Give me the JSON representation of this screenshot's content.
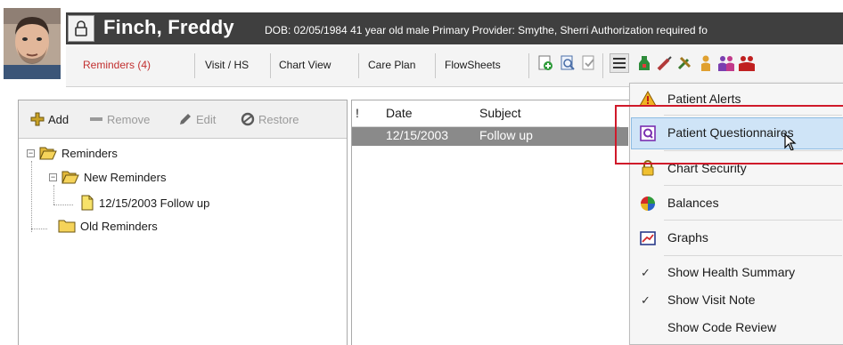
{
  "patient": {
    "name": "Finch, Freddy",
    "info": "DOB: 02/05/1984  41 year old male  Primary Provider: Smythe, Sherri  Authorization required fo"
  },
  "toolbar": {
    "reminders": "Reminders (4)",
    "visit": "Visit / HS",
    "chart_view": "Chart View",
    "care_plan": "Care Plan",
    "flowsheets": "FlowSheets"
  },
  "reminders_toolbar": {
    "add": "Add",
    "remove": "Remove",
    "edit": "Edit",
    "restore": "Restore"
  },
  "tree": {
    "root": "Reminders",
    "new_folder": "New Reminders",
    "item": "12/15/2003 Follow up",
    "old_folder": "Old Reminders"
  },
  "list": {
    "columns": [
      "!",
      "Date",
      "Subject"
    ],
    "rows": [
      {
        "date": "12/15/2003",
        "subject": "Follow up"
      }
    ]
  },
  "menu": {
    "items": [
      {
        "label": "Patient Alerts",
        "icon": "warning-icon"
      },
      {
        "label": "Patient Questionnaires",
        "icon": "questionnaire-icon"
      },
      {
        "label": "Chart Security",
        "icon": "lock-icon"
      },
      {
        "label": "Balances",
        "icon": "balances-pie-icon"
      },
      {
        "label": "Graphs",
        "icon": "graphs-icon"
      }
    ],
    "checks": [
      {
        "label": "Show Health Summary",
        "checked": true
      },
      {
        "label": "Show Visit Note",
        "checked": true
      },
      {
        "label": "Show Code Review",
        "checked": false
      }
    ]
  },
  "colors": {
    "header_bg": "#3f3f3f",
    "reminders_tab": "#c23030",
    "highlight": "#cfe4f7",
    "callout": "#d0192a"
  }
}
